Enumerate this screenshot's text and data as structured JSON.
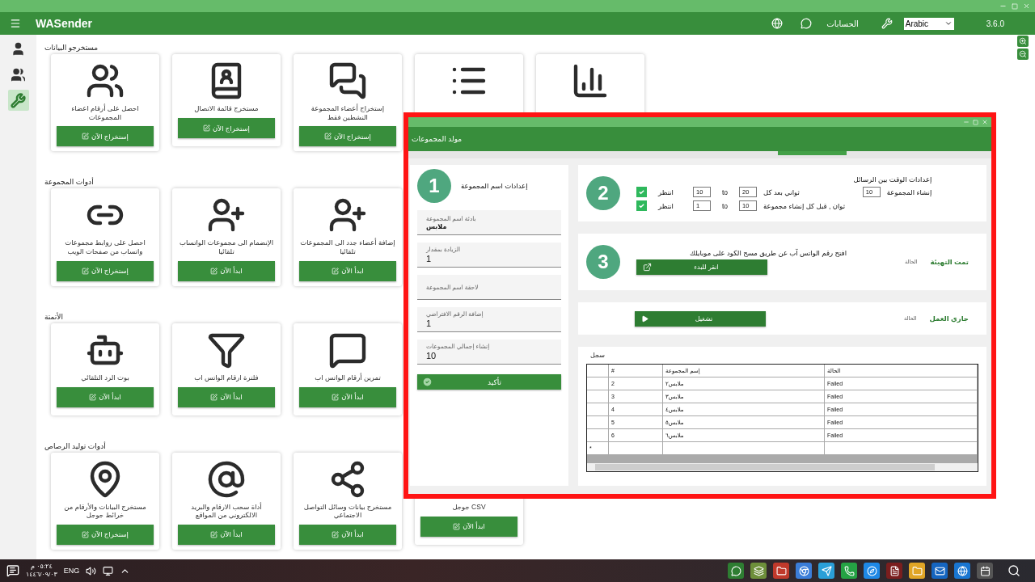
{
  "app_bar": {
    "title": "WASender",
    "accounts_label": "الحسابات",
    "language": "Arabic",
    "version": "3.6.0"
  },
  "sidebar": {
    "items": [
      {
        "selected": false
      },
      {
        "selected": false
      },
      {
        "selected": true
      }
    ]
  },
  "sections": [
    {
      "title": "مستخرجو البيانات",
      "cards": [
        {
          "kind": "covered"
        },
        {
          "kind": "covered"
        },
        {
          "kind": "tool",
          "label": "إستخراج أعضاء المجموعة النشطين فقط",
          "button": "إستخراج الآن"
        },
        {
          "kind": "tool",
          "label": "مستخرج قائمة الاتصال",
          "button": "إستخراج الآن"
        },
        {
          "kind": "tool",
          "label": "احصل على أرقام اعضاء المجموعات",
          "button": "إستخراج الآن"
        }
      ]
    },
    {
      "title": "أدوات المجموعة",
      "cards": [
        {
          "kind": "tool",
          "label": "إضافة أعضاء جدد الى المجموعات تلقائيا",
          "button": "ابدأ الآن"
        },
        {
          "kind": "tool",
          "label": "الإنضمام الى مجموعات الواتساب تلقائيا",
          "button": "ابدأ الآن"
        },
        {
          "kind": "tool",
          "label": "احصل على روابط مجموعات واتساب من صفحات الويب",
          "button": "إستخراج الآن"
        }
      ]
    },
    {
      "title": "الأتمتة",
      "cards": [
        {
          "kind": "tool",
          "label": "تمرين أرقام الواتس اب",
          "button": "ابدأ الآن"
        },
        {
          "kind": "tool",
          "label": "فلترة ارقام الواتس اب",
          "button": "ابدأ الآن"
        },
        {
          "kind": "tool",
          "label": "بوت الرد التلقائي",
          "button": "ابدأ الآن"
        }
      ]
    },
    {
      "title": "أدوات توليد الرصاص",
      "cards": [
        {
          "kind": "tool",
          "label": "CSV جوجل",
          "button": "ابدأ الآن"
        },
        {
          "kind": "tool",
          "label": "مستخرج بيانات وسائل التواصل الاجتماعي",
          "button": "ابدأ الآن"
        },
        {
          "kind": "tool",
          "label": "أداة سحب الارقام والبريد الالكتروني من المواقع",
          "button": "ابدأ الآن"
        },
        {
          "kind": "tool",
          "label": "مستخرج البيانات والأرقام من خرائط جوجل",
          "button": "إستخراج الآن"
        }
      ]
    }
  ],
  "dialog": {
    "title": "مولد المجموعات",
    "step1": {
      "number": "1",
      "title": "إعدادات اسم المجموعة",
      "fields": [
        {
          "label": "بادئة اسم المجموعة",
          "value": "ملابس"
        },
        {
          "label": "الزيادة بمقدار",
          "value": "1"
        },
        {
          "label": "لاحقة اسم المجموعة"
        },
        {
          "label": "إضافة الرقم الافتراضي",
          "value": "1"
        },
        {
          "label": "إنشاء إجمالي المجموعات",
          "value": "10"
        }
      ],
      "confirm": "تأكيد"
    },
    "step2": {
      "number": "2",
      "title": "إعدادات الوقت بين الرسائل",
      "rows": [
        {
          "checked": true,
          "wait": "انتظر",
          "from": "10",
          "to_label": "to",
          "to": "20",
          "after": "ثواني بعد كل",
          "count": "10",
          "count_label": "إنشاء المجموعة"
        },
        {
          "checked": true,
          "wait": "انتظر",
          "from": "1",
          "to_label": "to",
          "to": "10",
          "after": "ثوان , قبل كل إنشاء مجموعة"
        }
      ]
    },
    "step3": {
      "number": "3",
      "title": "افتح رقم الواتس آب عن طريق مسح الكود على موبايلك",
      "button": "انقر للبدء",
      "status_label": "الحالة",
      "status": "تمت التهيئة"
    },
    "step4": {
      "button": "تشغيل",
      "status_label": "الحالة",
      "status": "جاري العمل"
    },
    "log": {
      "title": "سجل",
      "columns": [
        "الحالة",
        "إسم المجموعة",
        "#"
      ],
      "rows": [
        [
          "Failed",
          "ملابس٢",
          "2"
        ],
        [
          "Failed",
          "ملابس٣",
          "3"
        ],
        [
          "Failed",
          "ملابس٤",
          "4"
        ],
        [
          "Failed",
          "ملابس٥",
          "5"
        ],
        [
          "Failed",
          "ملابس٦",
          "6"
        ]
      ],
      "new_row_marker": "*"
    }
  },
  "taskbar": {
    "time": "٠٥:٢٤ م",
    "date": "١٤٤٦/٠٩/٠٣",
    "language": "ENG"
  }
}
